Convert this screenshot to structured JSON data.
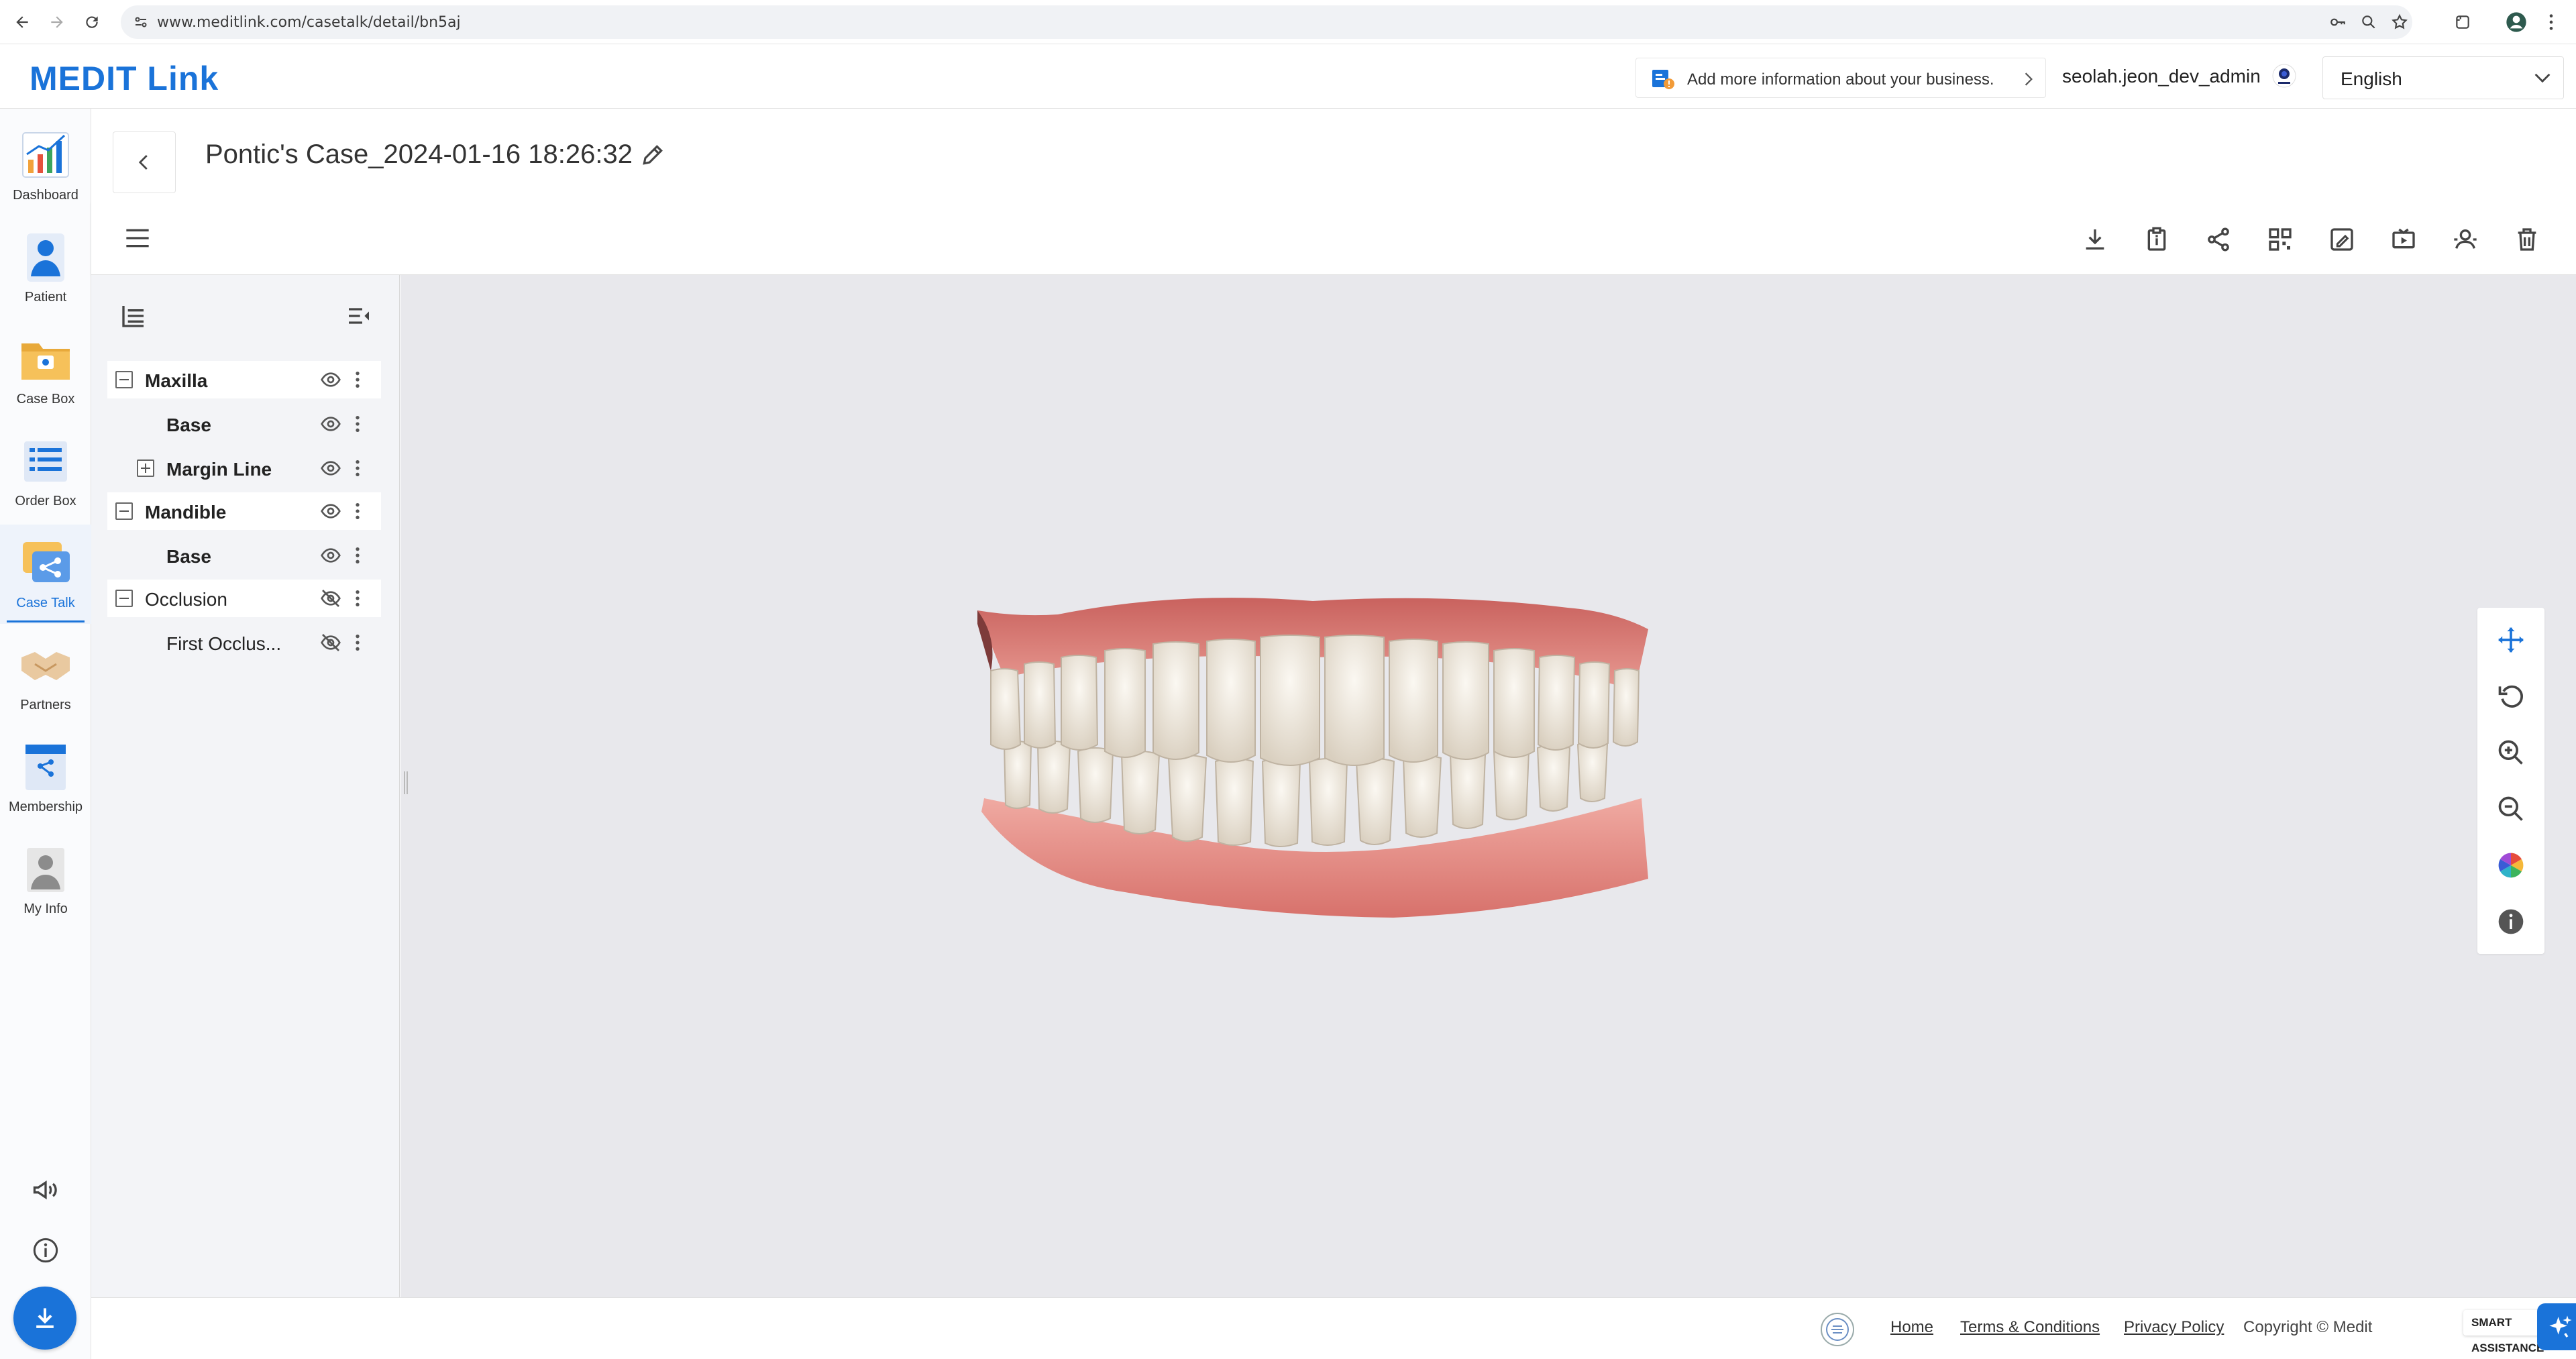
{
  "browser": {
    "url": "www.meditlink.com/casetalk/detail/bn5aj"
  },
  "header": {
    "logo": "MEDIT Link",
    "business_banner": "Add more information about your business.",
    "username": "seolah.jeon_dev_admin",
    "language": "English"
  },
  "nav": {
    "items": [
      {
        "label": "Dashboard"
      },
      {
        "label": "Patient"
      },
      {
        "label": "Case Box"
      },
      {
        "label": "Order Box"
      },
      {
        "label": "Case Talk"
      },
      {
        "label": "Partners"
      },
      {
        "label": "Membership"
      },
      {
        "label": "My Info"
      }
    ],
    "active": "Case Talk"
  },
  "page": {
    "title": "Pontic's Case_2024-01-16 18:26:32"
  },
  "tree": {
    "rows": [
      {
        "label": "Maxilla",
        "type": "group"
      },
      {
        "label": "Base",
        "type": "child"
      },
      {
        "label": "Margin Line",
        "type": "child-expandable"
      },
      {
        "label": "Mandible",
        "type": "group"
      },
      {
        "label": "Base",
        "type": "child"
      },
      {
        "label": "Occlusion",
        "type": "group"
      },
      {
        "label": "First Occlus...",
        "type": "child"
      }
    ]
  },
  "footer": {
    "home": "Home",
    "terms": "Terms & Conditions",
    "privacy": "Privacy Policy",
    "copyright": "Copyright © Medit",
    "smart_assistance": "SMART ASSISTANCE"
  },
  "colors": {
    "accent": "#1a73d9",
    "viewer_bg": "#e8e8ec",
    "gum": "#d9756f",
    "tooth": "#efe9de"
  }
}
